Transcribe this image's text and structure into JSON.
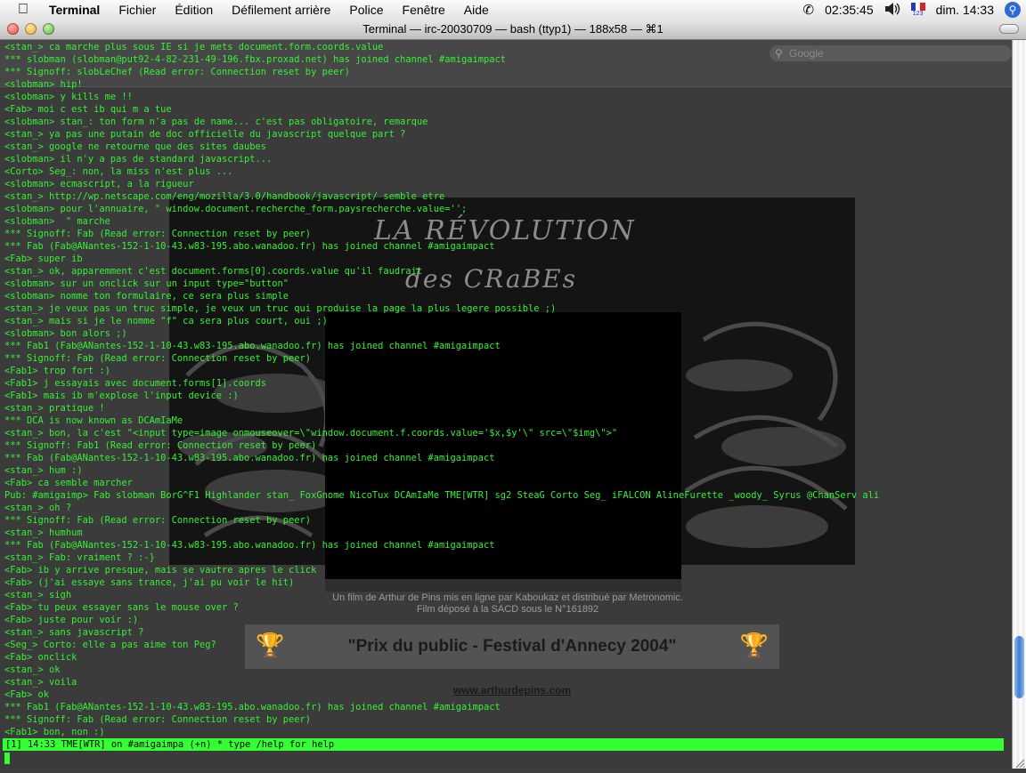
{
  "menubar": {
    "apple": "",
    "menus": [
      "Terminal",
      "Fichier",
      "Édition",
      "Défilement arrière",
      "Police",
      "Fenêtre",
      "Aide"
    ],
    "clock": "02:35:45",
    "date": "dim. 14:33",
    "flag_number": "123"
  },
  "window": {
    "title": "Terminal — irc-20030709 — bash (ttyp1) — 188x58 — ⌘1"
  },
  "background_page": {
    "search_placeholder": "Google",
    "headline_1": "LA RÉVOLUTION",
    "headline_2": "des CRaBEs",
    "credit_line_1": "Un film de Arthur de Pins mis en ligne par Kaboukaz et distribué par Metronomic.",
    "credit_line_2": "Film déposé à la SACD sous le N°161892",
    "banner": "\"Prix du public - Festival d'Annecy 2004\"",
    "site_url": "www.arthurdepins.com"
  },
  "terminal": {
    "lines": [
      "<stan_> ca marche plus sous IE si je mets document.form.coords.value",
      "*** slobman (slobman@put92-4-82-231-49-196.fbx.proxad.net) has joined channel #amigaimpact",
      "*** Signoff: slobLeChef (Read error: Connection reset by peer)",
      "<slobman> hip!",
      "<slobman> y kills me !!",
      "<Fab> moi c est ib qui m a tue",
      "<slobman> stan_: ton form n'a pas de name... c'est pas obligatoire, remarque",
      "<stan_> ya pas une putain de doc officielle du javascript quelque part ?",
      "<stan_> google ne retourne que des sites daubes",
      "<slobman> il n'y a pas de standard javascript...",
      "<Corto> Seg_: non, la miss n'est plus ...",
      "<slobman> ecmascript, a la rigueur",
      "<stan_> http://wp.netscape.com/eng/mozilla/3.0/handbook/javascript/ semble etre",
      "<slobman> pour l'annuaire, \" window.document.recherche_form.paysrecherche.value='';",
      "<slobman>  \" marche",
      "*** Signoff: Fab (Read error: Connection reset by peer)",
      "*** Fab (Fab@ANantes-152-1-10-43.w83-195.abo.wanadoo.fr) has joined channel #amigaimpact",
      "<Fab> super ib",
      "<stan_> ok, apparemment c'est document.forms[0].coords.value qu'il faudrait",
      "<slobman> sur un onclick sur un input type=\"button\"",
      "<slobman> nomme ton formulaire, ce sera plus simple",
      "<stan_> je veux pas un truc simple, je veux un truc qui produise la page la plus legere possible ;)",
      "<stan_> mais si je le nomme \"f\" ca sera plus court, oui ;)",
      "<slobman> bon alors ;)",
      "*** Fab1 (Fab@ANantes-152-1-10-43.w83-195.abo.wanadoo.fr) has joined channel #amigaimpact",
      "*** Signoff: Fab (Read error: Connection reset by peer)",
      "<Fab1> trop fort :)",
      "<Fab1> j essayais avec document.forms[1].coords",
      "<Fab1> mais ib m'explose l'input device :)",
      "<stan_> pratique !",
      "*** DCA is now known as DCAmIaMe",
      "<stan_> bon, la c'est \"<input type=image onmouseover=\\\"window.document.f.coords.value='$x,$y'\\\" src=\\\"$img\\\">\"",
      "*** Signoff: Fab1 (Read error: Connection reset by peer)",
      "*** Fab (Fab@ANantes-152-1-10-43.w83-195.abo.wanadoo.fr) has joined channel #amigaimpact",
      "<stan_> hum :)",
      "<Fab> ca semble marcher",
      "Pub: #amigaimp> Fab slobman BorG^F1 Highlander stan_ FoxGnome NicoTux DCAmIaMe TME[WTR] sg2 SteaG Corto Seg_ iFALCON AlineFurette _woody_ Syrus @ChanServ ali",
      "<stan_> oh ?",
      "*** Signoff: Fab (Read error: Connection reset by peer)",
      "<stan_> humhum",
      "*** Fab (Fab@ANantes-152-1-10-43.w83-195.abo.wanadoo.fr) has joined channel #amigaimpact",
      "<stan_> Fab: vraiment ? :-}",
      "<Fab> ib y arrive presque, mais se vautre apres le click",
      "<Fab> (j'ai essaye sans trance, j'ai pu voir le hit)",
      "<stan_> sigh",
      "<Fab> tu peux essayer sans le mouse over ?",
      "<Fab> juste pour voir :)",
      "<stan_> sans javascript ?",
      "<Seg_> Corto: elle a pas aime ton Peg?",
      "<Fab> onclick",
      "<stan_> ok",
      "<stan_> voila",
      "<Fab> ok",
      "*** Fab1 (Fab@ANantes-152-1-10-43.w83-195.abo.wanadoo.fr) has joined channel #amigaimpact",
      "*** Signoff: Fab (Read error: Connection reset by peer)",
      "<Fab1> bon, non :)"
    ],
    "status_line": "[1] 14:33 TME[WTR] on #amigaimpa (+n) * type /help for help"
  },
  "scrollbar": {
    "position": 0.92,
    "visible_fraction": 0.09
  },
  "colors": {
    "terminal_text": "#38ee38",
    "status_bar": "#33ff33",
    "scroll_thumb": "#3d7fd4"
  }
}
